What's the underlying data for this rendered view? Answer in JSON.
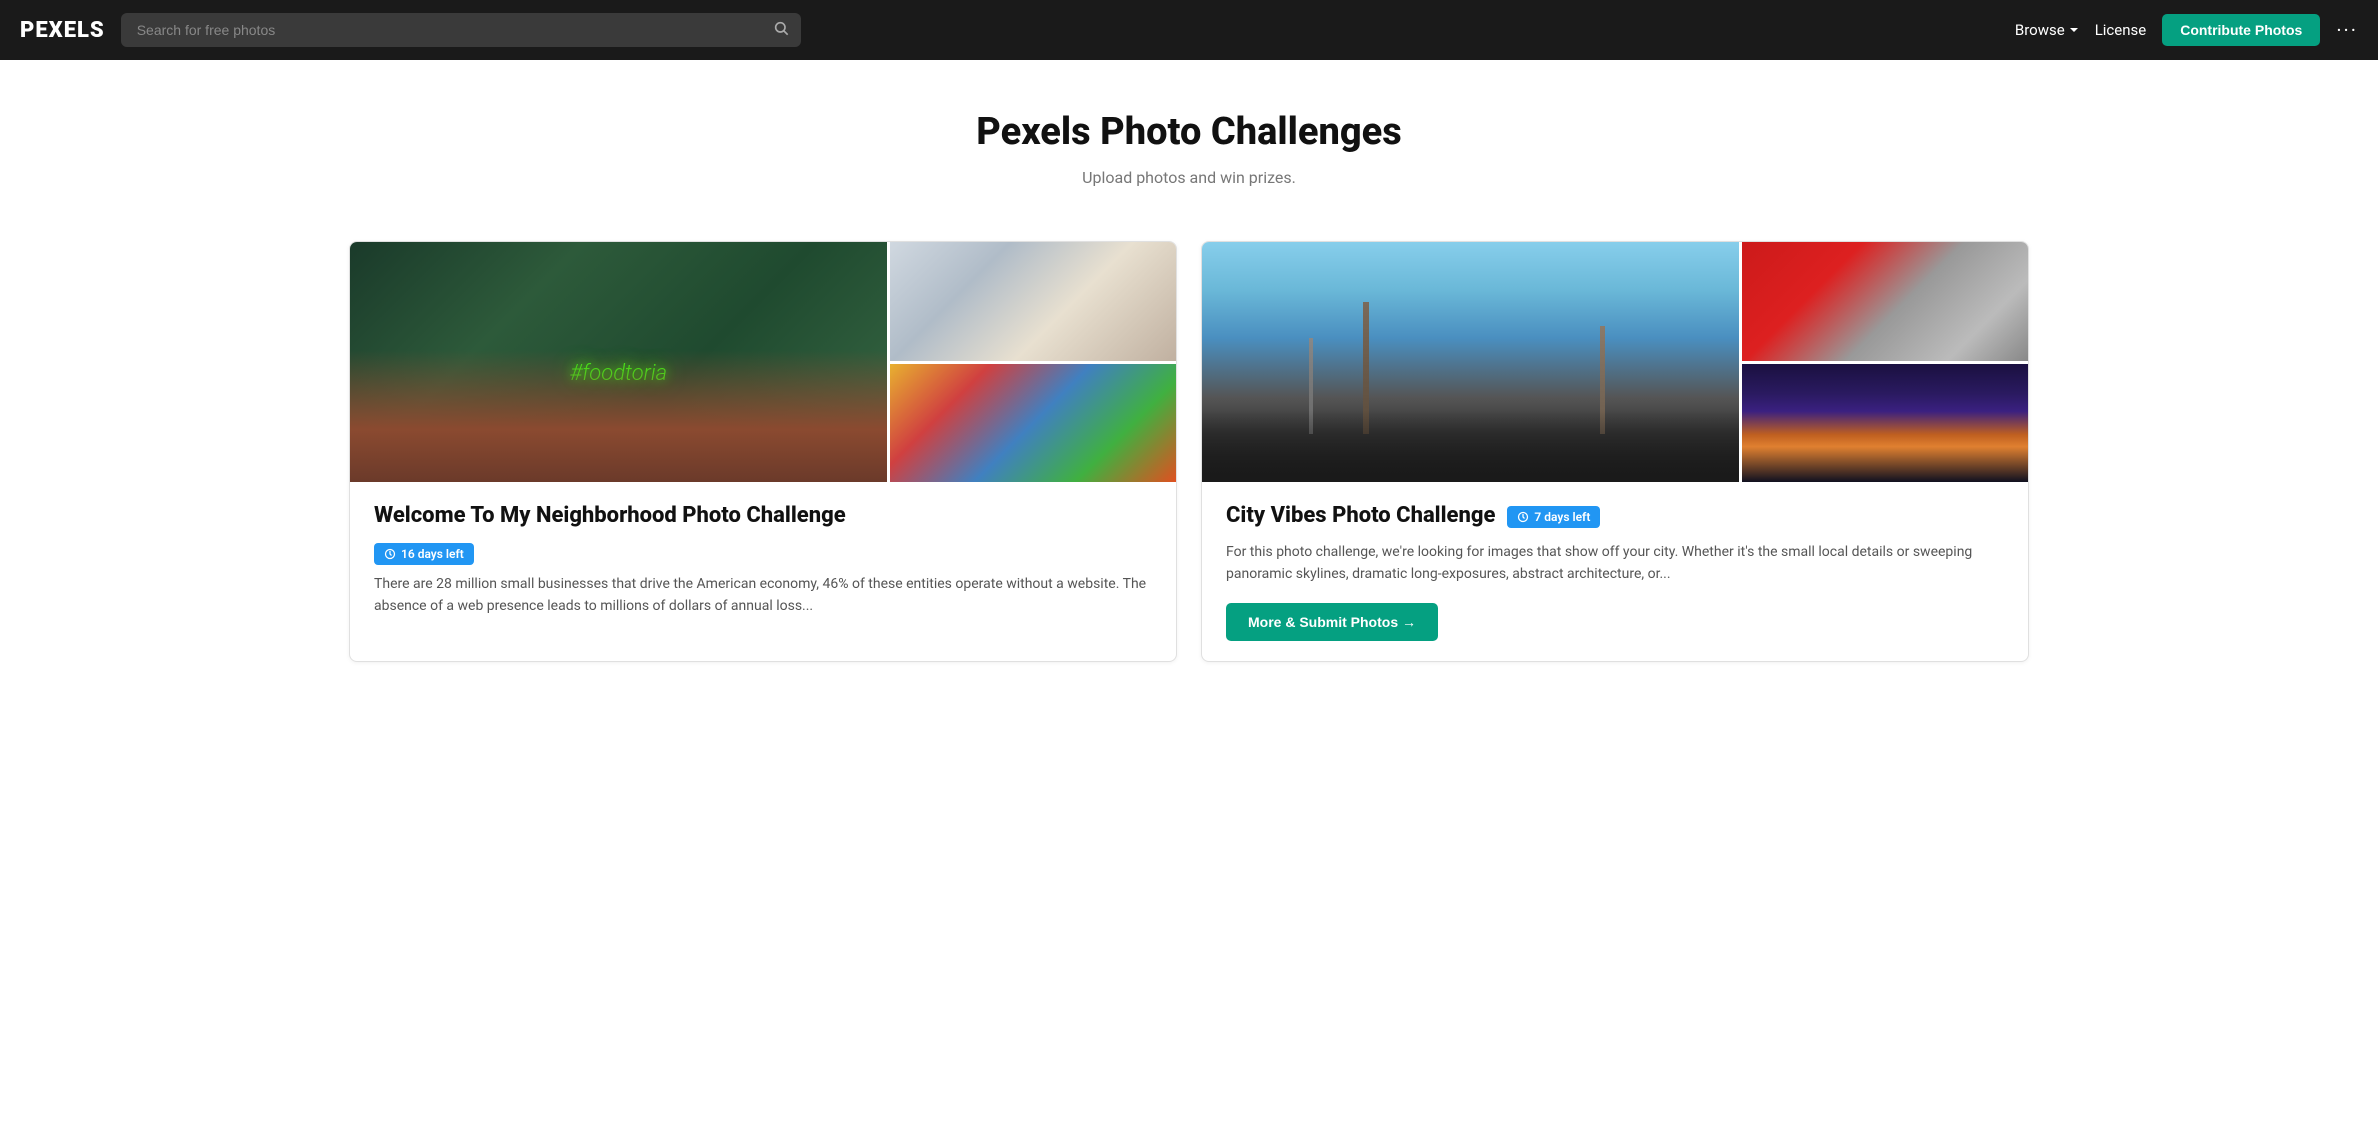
{
  "navbar": {
    "logo": "PEXELS",
    "search_placeholder": "Search for free photos",
    "browse_label": "Browse",
    "license_label": "License",
    "contribute_label": "Contribute Photos",
    "dots_label": "···"
  },
  "hero": {
    "title": "Pexels Photo Challenges",
    "subtitle": "Upload photos and win prizes."
  },
  "cards": [
    {
      "id": "neighborhood",
      "title": "Welcome To My Neighborhood Photo Challenge",
      "badge": "16 days left",
      "description": "There are 28 million small businesses that drive the American economy, 46% of these entities operate without a website. The absence of a web presence leads to millions of dollars of annual loss...",
      "cta": null
    },
    {
      "id": "city",
      "title": "City Vibes Photo Challenge",
      "badge": "7 days left",
      "description": "For this photo challenge, we're looking for images that show off your city. Whether it's the small local details or sweeping panoramic skylines, dramatic long-exposures, abstract architecture, or...",
      "cta": "More & Submit Photos →"
    }
  ]
}
